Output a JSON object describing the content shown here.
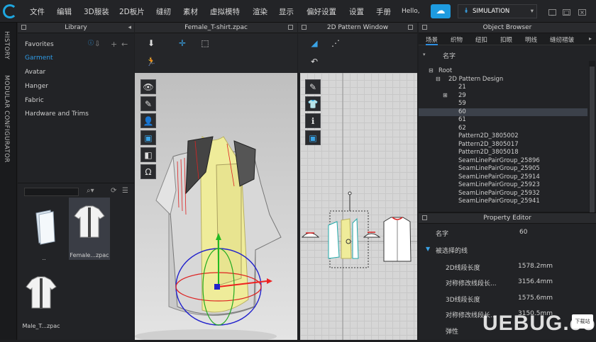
{
  "menu": {
    "items": [
      "文件",
      "编辑",
      "3D服装",
      "2D板片",
      "缝纫",
      "素材",
      "虚拟模特",
      "渲染",
      "显示",
      "偏好设置",
      "设置",
      "手册"
    ],
    "greeting": "Hello,",
    "simulation_label": "SIMULATION",
    "cloud_icon": "cloud-icon",
    "window_buttons": [
      "_",
      "□",
      "×"
    ]
  },
  "vtabs": [
    "HISTORY",
    "MODULAR CONFIGURATOR"
  ],
  "library": {
    "title": "Library",
    "favorites": "Favorites",
    "items": [
      "Garment",
      "Avatar",
      "Hanger",
      "Fabric",
      "Hardware and Trims"
    ],
    "active": "Garment",
    "files": [
      {
        "label": "..",
        "icon": "folder-icon"
      },
      {
        "label": "Female...zpac",
        "icon": "garment-icon",
        "selected": true
      },
      {
        "label": "Male_T...zpac",
        "icon": "garment-icon"
      }
    ]
  },
  "view3d": {
    "title": "Female_T-shirt.zpac"
  },
  "view2d": {
    "title": "2D Pattern Window"
  },
  "object_browser": {
    "title": "Object Browser",
    "tabs": [
      "场景",
      "织物",
      "纽扣",
      "扣眼",
      "明线",
      "缝纫褶皱"
    ],
    "column": "名字",
    "tree": [
      {
        "label": "Root",
        "indent": 0,
        "expander": "⊟"
      },
      {
        "label": "2D Pattern Design",
        "indent": 1,
        "expander": "⊟"
      },
      {
        "label": "21",
        "indent": 2,
        "expander": ""
      },
      {
        "label": "29",
        "indent": 2,
        "expander": "⊞"
      },
      {
        "label": "59",
        "indent": 2,
        "expander": ""
      },
      {
        "label": "60",
        "indent": 2,
        "expander": "",
        "selected": true
      },
      {
        "label": "61",
        "indent": 2,
        "expander": ""
      },
      {
        "label": "62",
        "indent": 2,
        "expander": ""
      },
      {
        "label": "Pattern2D_3805002",
        "indent": 2,
        "expander": ""
      },
      {
        "label": "Pattern2D_3805017",
        "indent": 2,
        "expander": ""
      },
      {
        "label": "Pattern2D_3805018",
        "indent": 2,
        "expander": ""
      },
      {
        "label": "SeamLinePairGroup_25896",
        "indent": 2,
        "expander": ""
      },
      {
        "label": "SeamLinePairGroup_25905",
        "indent": 2,
        "expander": ""
      },
      {
        "label": "SeamLinePairGroup_25914",
        "indent": 2,
        "expander": ""
      },
      {
        "label": "SeamLinePairGroup_25923",
        "indent": 2,
        "expander": ""
      },
      {
        "label": "SeamLinePairGroup_25932",
        "indent": 2,
        "expander": ""
      },
      {
        "label": "SeamLinePairGroup_25941",
        "indent": 2,
        "expander": ""
      }
    ]
  },
  "property_editor": {
    "title": "Property Editor",
    "name_label": "名字",
    "name_value": "60",
    "section": "被选择的线",
    "rows": [
      {
        "label": "2D线段长度",
        "value": "1578.2mm"
      },
      {
        "label": "对称修改线段长...",
        "value": "3156.4mm"
      },
      {
        "label": "3D线段长度",
        "value": "1575.6mm"
      },
      {
        "label": "对称修改线段长...",
        "value": "3150.5mm"
      },
      {
        "label": "弹性",
        "value": ""
      }
    ]
  },
  "watermark": {
    "text": "UEBUG.com",
    "badge": "下载站"
  }
}
